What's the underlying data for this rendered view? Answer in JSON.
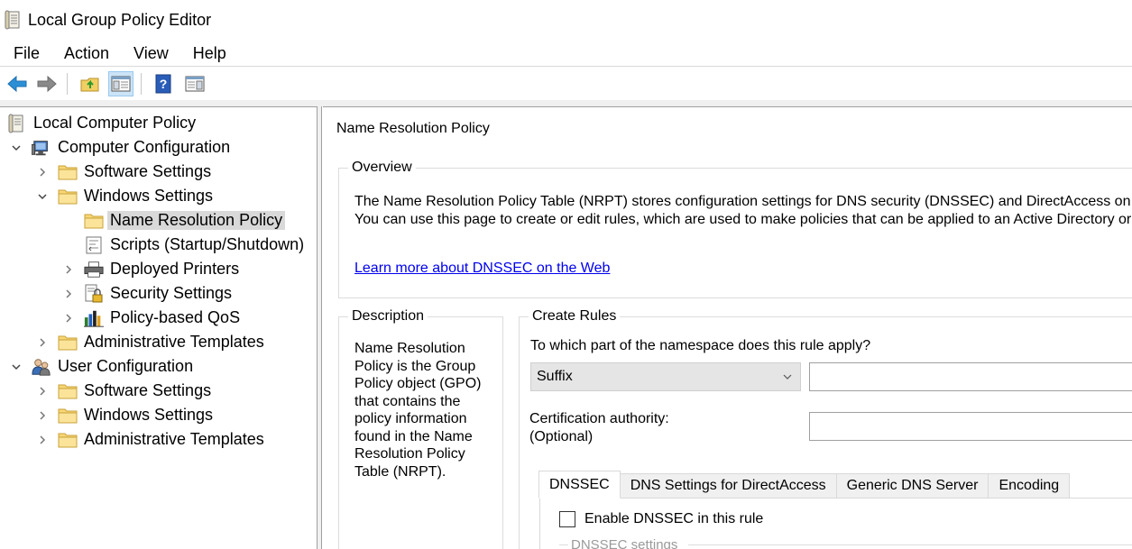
{
  "window": {
    "title": "Local Group Policy Editor",
    "icon": "policy-document-icon"
  },
  "menu": [
    "File",
    "Action",
    "View",
    "Help"
  ],
  "toolbar": {
    "buttons": [
      "back-arrow-icon",
      "forward-arrow-icon",
      "up-folder-icon",
      "show-hide-tree-icon",
      "help-icon",
      "show-action-pane-icon"
    ]
  },
  "tree": {
    "root": "Local Computer Policy",
    "computer_configuration": "Computer Configuration",
    "cc_software_settings": "Software Settings",
    "cc_windows_settings": "Windows Settings",
    "name_resolution_policy": "Name Resolution Policy",
    "scripts": "Scripts (Startup/Shutdown)",
    "deployed_printers": "Deployed Printers",
    "security_settings": "Security Settings",
    "policy_based_qos": "Policy-based QoS",
    "cc_administrative_templates": "Administrative Templates",
    "user_configuration": "User Configuration",
    "uc_software_settings": "Software Settings",
    "uc_windows_settings": "Windows Settings",
    "uc_administrative_templates": "Administrative Templates"
  },
  "content": {
    "title": "Name Resolution Policy",
    "overview": {
      "legend": "Overview",
      "line1": "The Name Resolution Policy Table (NRPT) stores configuration settings for DNS security (DNSSEC) and DirectAccess on",
      "line2": "You can use this page to create or edit rules, which are used to make policies that can be applied to an Active Directory or",
      "link": "Learn more about DNSSEC on the Web"
    },
    "description": {
      "legend": "Description",
      "text": "Name Resolution Policy is the Group Policy object (GPO) that contains the policy information found in the Name Resolution Policy Table (NRPT)."
    },
    "create_rules": {
      "legend": "Create Rules",
      "question": "To which part of the namespace does this rule apply?",
      "namespace_option": "Suffix",
      "namespace_value": "",
      "cert_label_1": "Certification authority:",
      "cert_label_2": "(Optional)",
      "cert_value": "",
      "tabs": [
        "DNSSEC",
        "DNS Settings for DirectAccess",
        "Generic DNS Server",
        "Encoding"
      ],
      "active_tab": "DNSSEC",
      "enable_dnssec_label": "Enable DNSSEC in this rule",
      "enable_dnssec_checked": false,
      "dnssec_settings_label": "DNSSEC settings"
    }
  }
}
